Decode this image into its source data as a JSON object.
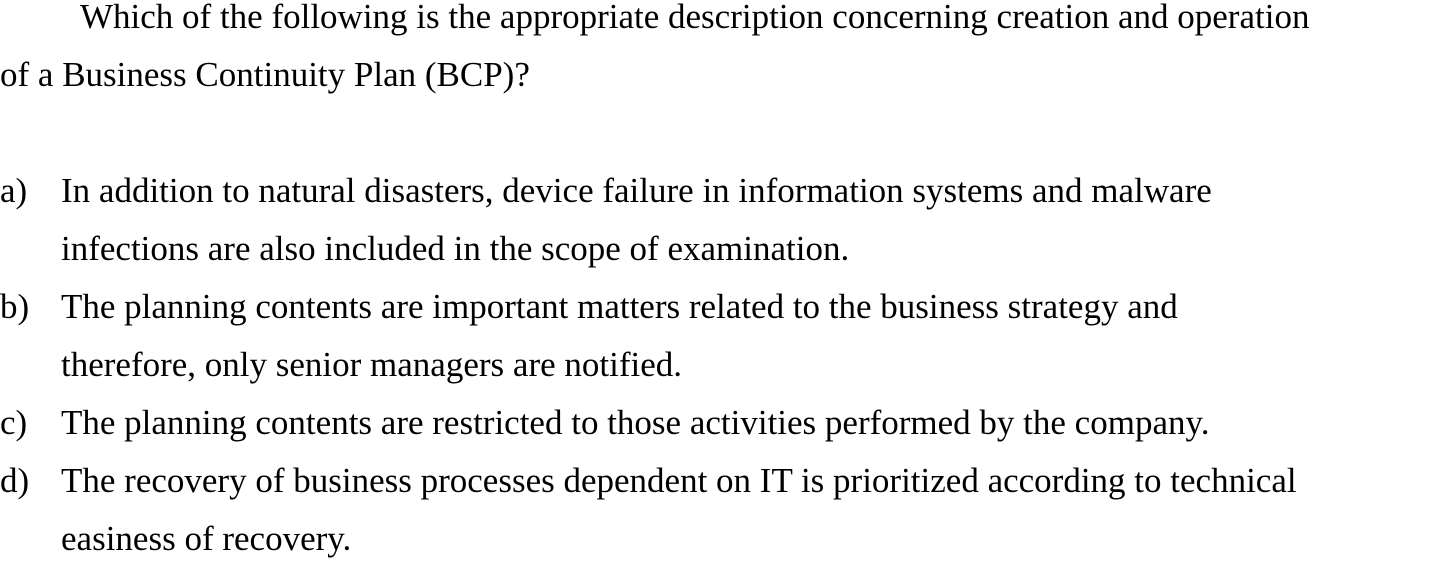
{
  "question": {
    "line1": "Which of the following is the appropriate description concerning creation and operation",
    "line2": "of a Business Continuity Plan (BCP)?"
  },
  "options": [
    {
      "letter": "a)",
      "lines": [
        "In addition to natural disasters, device failure in information systems and malware",
        "infections are also included in the scope of examination."
      ]
    },
    {
      "letter": "b)",
      "lines": [
        "The planning contents are important matters related to the business strategy and",
        "therefore, only senior managers are notified."
      ]
    },
    {
      "letter": "c)",
      "lines": [
        "The planning contents are restricted to those activities performed by the company."
      ]
    },
    {
      "letter": "d)",
      "lines": [
        "The recovery of business processes dependent on IT is prioritized according to technical",
        "easiness of recovery."
      ]
    }
  ]
}
